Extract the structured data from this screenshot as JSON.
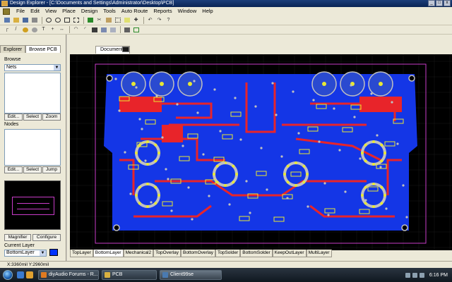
{
  "window": {
    "title": "Design Explorer - [C:\\Documents and Settings\\Administrator\\Desktop\\PCB]",
    "controls": [
      "minimize",
      "maximize",
      "close"
    ]
  },
  "menu": [
    "File",
    "Edit",
    "View",
    "Place",
    "Design",
    "Tools",
    "Auto Route",
    "Reports",
    "Window",
    "Help"
  ],
  "panel": {
    "tabs": [
      "Explorer",
      "Browse PCB"
    ],
    "active_tab": "Browse PCB",
    "browse_label": "Browse",
    "browse_value": "Nets",
    "edit_label": "Edit...",
    "select_label": "Select",
    "zoom_label": "Zoom",
    "nodes_label": "Nodes",
    "jump_label": "Jump",
    "magnifier_label": "Magnifier",
    "configure_label": "Configure",
    "current_layer_label": "Current Layer",
    "current_layer_value": "BottomLayer",
    "current_layer_color": "#0033ff"
  },
  "document": {
    "tab_label": "Documents"
  },
  "layers": [
    "TopLayer",
    "BottomLayer",
    "Mechanical2",
    "TopOverlay",
    "BottomOverlay",
    "TopSolder",
    "BottomSolder",
    "KeepOutLayer",
    "MultiLayer"
  ],
  "active_layer": "BottomLayer",
  "status": {
    "coords": "X:3360mil Y:2960mil"
  },
  "taskbar": {
    "items": [
      {
        "label": "diyAudio Forums - R...",
        "color": "#e07a20"
      },
      {
        "label": "PCB",
        "color": "#d9b040"
      },
      {
        "label": "Client99se",
        "color": "#4a7ab0"
      }
    ],
    "active_item": "Client99se",
    "clock": "6:16 PM"
  },
  "colors": {
    "top_layer": "#e8242a",
    "bottom_layer": "#1436e6",
    "overlay": "#e8e834",
    "multi_layer": "#c0c0c0",
    "keepout": "#c83cc8",
    "canvas_bg": "#000000"
  }
}
